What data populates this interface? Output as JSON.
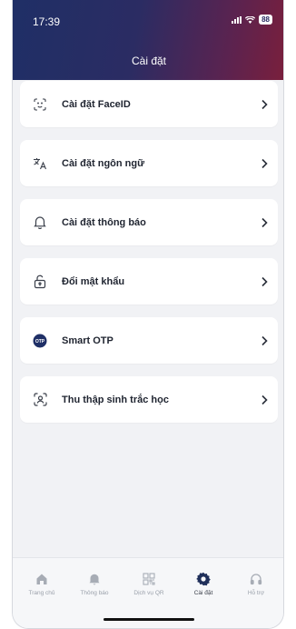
{
  "status_bar": {
    "time": "17:39",
    "battery": "88"
  },
  "header": {
    "title": "Cài đặt"
  },
  "menu": {
    "items": [
      {
        "label": "Cài đặt FaceID",
        "icon": "faceid-icon"
      },
      {
        "label": "Cài đặt ngôn ngữ",
        "icon": "translate-icon"
      },
      {
        "label": "Cài đặt thông báo",
        "icon": "bell-icon"
      },
      {
        "label": "Đổi mật khẩu",
        "icon": "lock-icon"
      },
      {
        "label": "Smart OTP",
        "icon": "otp-icon",
        "badge": "OTP"
      },
      {
        "label": "Thu thập sinh trắc học",
        "icon": "biometric-scan-icon"
      }
    ]
  },
  "tabbar": {
    "tabs": [
      {
        "label": "Trang chủ",
        "icon": "home-icon"
      },
      {
        "label": "Thông báo",
        "icon": "bell-icon"
      },
      {
        "label": "Dịch vụ QR",
        "icon": "qr-icon"
      },
      {
        "label": "Cài đặt",
        "icon": "gear-icon",
        "active": true
      },
      {
        "label": "Hỗ trợ",
        "icon": "headset-icon"
      }
    ]
  },
  "colors": {
    "header_start": "#1f2f66",
    "header_end": "#7a1f3c",
    "background": "#f1f2f5"
  }
}
